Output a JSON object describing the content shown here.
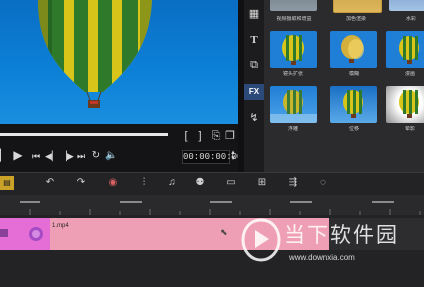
{
  "library": {
    "captions": [
      "视频摄取和增益",
      "加色渲染",
      "水彩",
      "镜头扩张",
      "模糊",
      "漫画",
      "浮雕",
      "位移",
      "晕影"
    ],
    "tools": [
      "media-icon",
      "title-icon",
      "transition-icon",
      "fx-icon",
      "path-icon"
    ],
    "fx_label": "FX"
  },
  "player": {
    "play_glyph": "▶",
    "timecode": "00:00:00:00",
    "bracket_in": "[",
    "bracket_out": "]"
  },
  "timeline": {
    "clip_name": "1.mp4"
  },
  "watermark": {
    "text": "当下软件园",
    "url": "www.downxia.com"
  }
}
